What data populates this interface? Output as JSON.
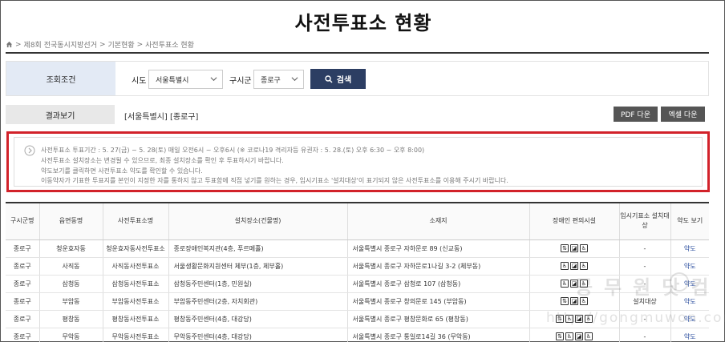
{
  "page": {
    "title": "사전투표소 현황"
  },
  "breadcrumb": [
    "제8회 전국동시지방선거",
    "기본현황",
    "사전투표소 현황"
  ],
  "filter": {
    "label": "조회조건",
    "sido_label": "시도",
    "sido_value": "서울특별시",
    "gugun_label": "구시군",
    "gugun_value": "종로구",
    "search_label": "검색"
  },
  "result": {
    "label": "결과보기",
    "text": "[서울특별시] [종로구]",
    "pdf_label": "PDF 다운",
    "excel_label": "엑셀 다운"
  },
  "notice": {
    "lines": [
      "사전투표소 투표기간 : 5. 27(금) ~ 5. 28(토) 매일 오전6시 ~ 오후6시 (※ 코로나19 격리자등 유권자 : 5. 28.(토) 오후 6:30 ~ 오후 8:00)",
      "사전투표소 설치장소는 변경될 수 있으므로, 최종 설치장소를 확인 후 투표하시기 바랍니다.",
      "약도보기를 클릭하면 사전투표소 약도를 확인할 수 있습니다.",
      "이동약자가 기표한 투표지를 본인이 지정한 자를 통하지 않고 투표함에 직접 넣기를 원하는 경우, 임시기표소 '설치대상'이 표기되지 않은 사전투표소를 이용해 주시기 바랍니다."
    ]
  },
  "table": {
    "headers": [
      "구시군명",
      "읍면동명",
      "사전투표소명",
      "설치장소(건물명)",
      "소재지",
      "장애인 편의시설",
      "임시기표소 설치대상",
      "약도 보기"
    ],
    "rows": [
      {
        "gu": "종로구",
        "dong": "청운효자동",
        "name": "청운효자동사전투표소",
        "place": "종로장애인복지관(4층, 푸르메홀)",
        "addr": "서울특별시 종로구 자하문로 89 (신교동)",
        "icons": [
          "elevator-icon",
          "ramp-icon",
          "wheelchair-icon"
        ],
        "temp": "-",
        "map": "약도"
      },
      {
        "gu": "종로구",
        "dong": "사직동",
        "name": "사직동사전투표소",
        "place": "서울생활문화지원센터 체부(1층, 체부홀)",
        "addr": "서울특별시 종로구 자하문로1나길 3-2 (체부동)",
        "icons": [
          "wheelchair-icon",
          "ramp-icon",
          "wheelchair-icon"
        ],
        "temp": "-",
        "map": "약도"
      },
      {
        "gu": "종로구",
        "dong": "삼청동",
        "name": "삼청동사전투표소",
        "place": "삼청동주민센터(1층, 민원실)",
        "addr": "서울특별시 종로구 삼청로 107 (삼청동)",
        "icons": [
          "wheelchair-icon",
          "ramp-icon",
          "wheelchair-icon"
        ],
        "temp": "-",
        "map": "약도"
      },
      {
        "gu": "종로구",
        "dong": "부암동",
        "name": "부암동사전투표소",
        "place": "부암동주민센터(2층, 자치회관)",
        "addr": "서울특별시 종로구 창의문로 145 (부암동)",
        "icons": [
          "elevator-icon",
          "ramp-icon",
          "wheelchair-icon"
        ],
        "temp": "설치대상",
        "map": "약도"
      },
      {
        "gu": "종로구",
        "dong": "평창동",
        "name": "평창동사전투표소",
        "place": "평창동주민센터(4층, 대강당)",
        "addr": "서울특별시 종로구 평창문화로 65 (평창동)",
        "icons": [
          "elevator-icon",
          "wheelchair-icon",
          "ramp-icon",
          "wheelchair-icon"
        ],
        "temp": "-",
        "map": "약도"
      },
      {
        "gu": "종로구",
        "dong": "무악동",
        "name": "무악동사전투표소",
        "place": "무악동주민센터(4층, 대강당)",
        "addr": "서울특별시 종로구 통일로14길 36 (무악동)",
        "icons": [
          "elevator-icon",
          "wheelchair-icon",
          "ramp-icon",
          "wheelchair-icon"
        ],
        "temp": "-",
        "map": "약도"
      }
    ]
  },
  "watermark": {
    "line1": "공무원닷컴",
    "line2": "http://gongmuwon.com"
  },
  "colors": {
    "accent": "#2c3e63",
    "notice_border": "#d2222a",
    "link": "#2a4d9e"
  }
}
